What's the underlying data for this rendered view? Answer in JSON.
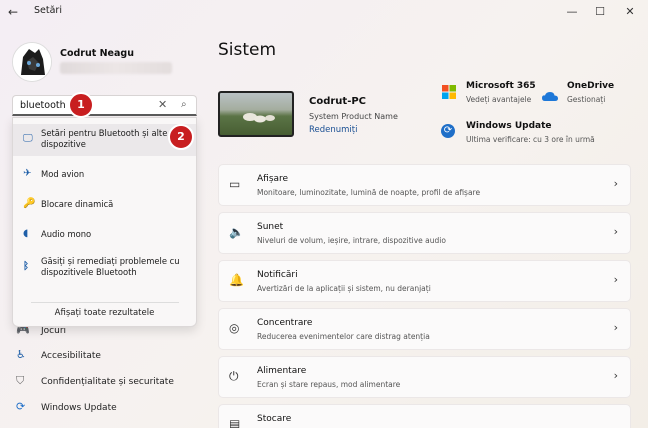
{
  "window": {
    "title": "Setări",
    "back_icon": "←",
    "minimize_icon": "—",
    "maximize_icon": "☐",
    "close_icon": "✕"
  },
  "account": {
    "name": "Codrut Neagu"
  },
  "search": {
    "value": "bluetooth",
    "clear_icon": "✕",
    "search_icon": "⌕",
    "badge1": "1",
    "badge2": "2",
    "results": [
      {
        "label": "Setări pentru Bluetooth și alte dispozitive",
        "icon": "🖵",
        "icon_name": "devices-icon"
      },
      {
        "label": "Mod avion",
        "icon": "✈",
        "icon_name": "airplane-icon"
      },
      {
        "label": "Blocare dinamică",
        "icon": "🔑",
        "icon_name": "key-icon"
      },
      {
        "label": "Audio mono",
        "icon": "◖",
        "icon_name": "audio-icon"
      },
      {
        "label": "Găsiți și remediați problemele cu dispozitivele Bluetooth",
        "icon": "ᛒ",
        "icon_name": "bluetooth-icon"
      }
    ],
    "show_all": "Afișați toate rezultatele"
  },
  "nav": [
    {
      "label": "Jocuri",
      "icon": "🎮",
      "icon_name": "gamepad-icon"
    },
    {
      "label": "Accesibilitate",
      "icon": "♿",
      "icon_name": "accessibility-icon"
    },
    {
      "label": "Confidențialitate și securitate",
      "icon": "⛉",
      "icon_name": "shield-icon"
    },
    {
      "label": "Windows Update",
      "icon": "⟳",
      "icon_name": "windows-update-icon"
    }
  ],
  "main": {
    "title": "Sistem",
    "pc": {
      "name": "Codrut-PC",
      "model": "System Product Name",
      "rename": "Redenumiți"
    },
    "services": [
      {
        "title": "Microsoft 365",
        "sub": "Vedeți avantajele",
        "icon_name": "microsoft365-icon"
      },
      {
        "title": "OneDrive",
        "sub": "Gestionați",
        "icon_name": "onedrive-icon"
      },
      {
        "title": "Windows Update",
        "sub": "Ultima verificare: cu 3 ore în urmă",
        "icon_name": "update-icon"
      }
    ],
    "cards": [
      {
        "title": "Afișare",
        "sub": "Monitoare, luminozitate, lumină de noapte, profil de afișare",
        "icon": "▭",
        "icon_name": "display-icon"
      },
      {
        "title": "Sunet",
        "sub": "Niveluri de volum, ieșire, intrare, dispozitive audio",
        "icon": "🔈",
        "icon_name": "sound-icon"
      },
      {
        "title": "Notificări",
        "sub": "Avertizări de la aplicații și sistem, nu deranjați",
        "icon": "🔔",
        "icon_name": "bell-icon"
      },
      {
        "title": "Concentrare",
        "sub": "Reducerea evenimentelor care distrag atenția",
        "icon": "◎",
        "icon_name": "focus-icon"
      },
      {
        "title": "Alimentare",
        "sub": "Ecran și stare repaus, mod alimentare",
        "icon": "⏻",
        "icon_name": "power-icon"
      },
      {
        "title": "Stocare",
        "sub": "",
        "icon": "▤",
        "icon_name": "storage-icon"
      }
    ],
    "chevron": "›"
  },
  "colors": {
    "accent": "#1a4f93",
    "badge": "#c81e20"
  }
}
